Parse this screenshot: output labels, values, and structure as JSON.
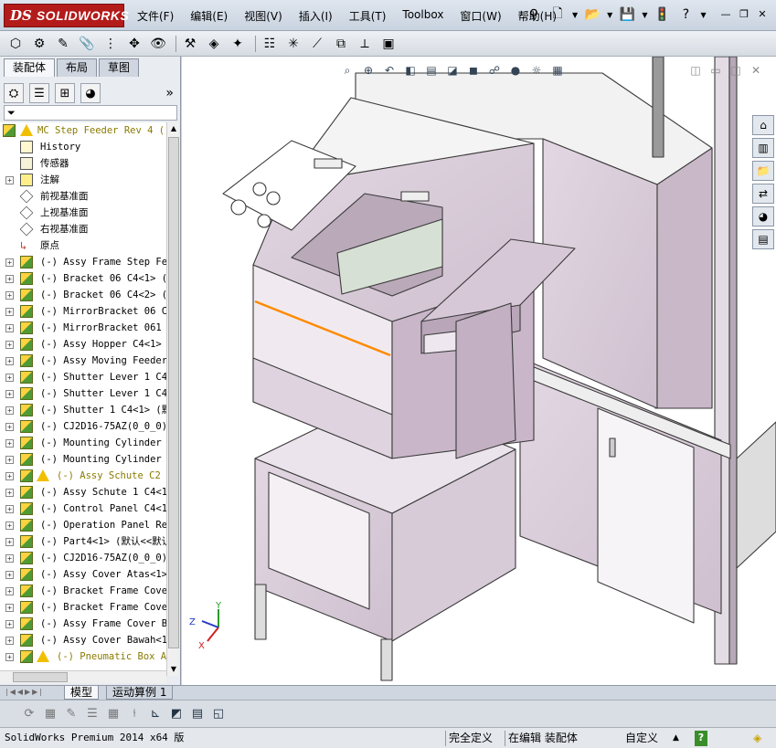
{
  "app": {
    "logo_ds": "DS",
    "logo_name": "SOLIDWORKS",
    "menu": [
      "文件(F)",
      "编辑(E)",
      "视图(V)",
      "插入(I)",
      "工具(T)",
      "Toolbox",
      "窗口(W)",
      "帮助(H)"
    ],
    "help_symbol": "?",
    "colors": {
      "logo_red": "#b31b1b",
      "part_face": "#d9ccd8",
      "part_edge": "#3a3a3a",
      "highlight_edge": "#ff8a00",
      "warning_yellow": "#f0c000",
      "tree_warn_text": "#8a7b00"
    }
  },
  "left_panel": {
    "tabs": [
      "装配体",
      "布局",
      "草图"
    ],
    "active_tab": "装配体",
    "filter_icon": "filter-icon",
    "tree": [
      {
        "label": "MC Step Feeder Rev 4  (",
        "type": "root",
        "warn": true
      },
      {
        "label": "History",
        "type": "history"
      },
      {
        "label": "传感器",
        "type": "sensors"
      },
      {
        "label": "注解",
        "type": "annotations",
        "expand": true
      },
      {
        "label": "前视基准面",
        "type": "plane"
      },
      {
        "label": "上视基准面",
        "type": "plane"
      },
      {
        "label": "右视基准面",
        "type": "plane"
      },
      {
        "label": "原点",
        "type": "origin"
      },
      {
        "label": "(-) Assy Frame Step Fee",
        "type": "part",
        "expand": true
      },
      {
        "label": "(-) Bracket 06 C4<1> (默",
        "type": "part",
        "expand": true
      },
      {
        "label": "(-) Bracket 06 C4<2> (默",
        "type": "part",
        "expand": true
      },
      {
        "label": "(-) MirrorBracket 06 C4",
        "type": "part",
        "expand": true
      },
      {
        "label": "(-) MirrorBracket 061 C",
        "type": "part",
        "expand": true
      },
      {
        "label": "(-) Assy Hopper C4<1> (",
        "type": "part",
        "expand": true
      },
      {
        "label": "(-) Assy Moving Feeder",
        "type": "part",
        "expand": true
      },
      {
        "label": "(-) Shutter Lever 1 C4<",
        "type": "part",
        "expand": true
      },
      {
        "label": "(-) Shutter Lever 1 C4<",
        "type": "part",
        "expand": true
      },
      {
        "label": "(-) Shutter 1 C4<1> (默",
        "type": "part",
        "expand": true
      },
      {
        "label": "(-) CJ2D16-75AZ(0_0_0)(",
        "type": "part",
        "expand": true
      },
      {
        "label": "(-) Mounting Cylinder 2",
        "type": "part",
        "expand": true
      },
      {
        "label": "(-) Mounting Cylinder 1",
        "type": "part",
        "expand": true
      },
      {
        "label": "(-) Assy Schute C2 C",
        "type": "part",
        "expand": true,
        "warn": true
      },
      {
        "label": "(-) Assy Schute 1 C4<1>",
        "type": "part",
        "expand": true
      },
      {
        "label": "(-) Control Panel C4<1>",
        "type": "part",
        "expand": true
      },
      {
        "label": "(-) Operation Panel Rev",
        "type": "part",
        "expand": true
      },
      {
        "label": "(-) Part4<1> (默认<<默认",
        "type": "part",
        "expand": true
      },
      {
        "label": "(-) CJ2D16-75AZ(0_0_0)(",
        "type": "part",
        "expand": true
      },
      {
        "label": "(-) Assy Cover Atas<1>",
        "type": "part",
        "expand": true
      },
      {
        "label": "(-) Bracket Frame Cover",
        "type": "part",
        "expand": true
      },
      {
        "label": "(-) Bracket Frame Cover",
        "type": "part",
        "expand": true
      },
      {
        "label": "(-) Assy Frame Cover Be",
        "type": "part",
        "expand": true
      },
      {
        "label": "(-) Assy Cover Bawah<1>",
        "type": "part",
        "expand": true
      },
      {
        "label": "(-) Pneumatic Box As",
        "type": "part",
        "expand": true,
        "warn": true
      }
    ]
  },
  "bottom_tabs": [
    "模型",
    "运动算例 1"
  ],
  "status_bar": {
    "version": "SolidWorks Premium 2014 x64 版",
    "definition": "完全定义",
    "editing": "在编辑 装配体",
    "custom": "自定义",
    "help": "?"
  },
  "triad": {
    "x": "X",
    "y": "Y",
    "z": "Z"
  }
}
